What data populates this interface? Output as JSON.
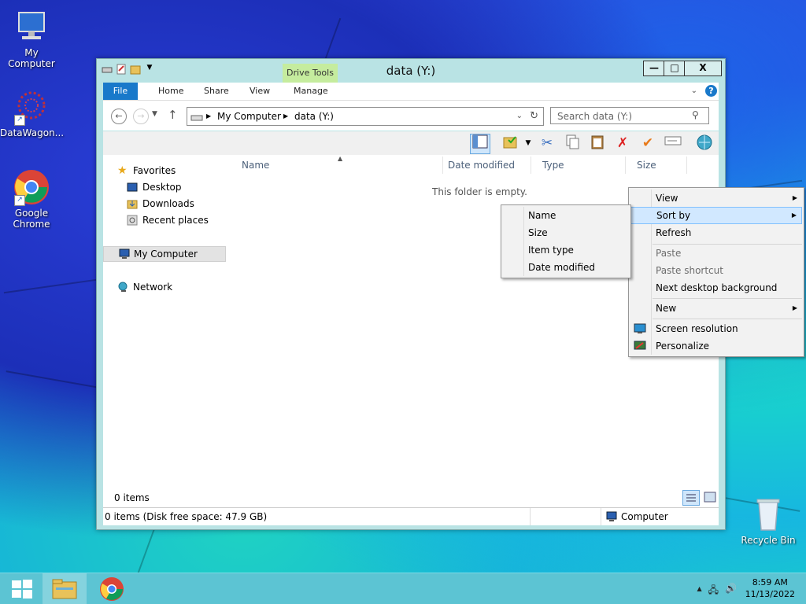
{
  "desktop": {
    "icons": [
      {
        "label": "My Computer"
      },
      {
        "label": "DataWagon..."
      },
      {
        "label": "Google Chrome"
      },
      {
        "label": "Recycle Bin"
      }
    ]
  },
  "window": {
    "title": "data (Y:)",
    "contextual_tab": "Drive Tools",
    "tabs": [
      "File",
      "Home",
      "Share",
      "View",
      "Manage"
    ],
    "help_label": "?",
    "buttons": {
      "minimize": "—",
      "maximize": "□",
      "close": "X"
    }
  },
  "address": {
    "crumbs": [
      "My Computer",
      "data (Y:)"
    ],
    "search_placeholder": "Search data (Y:)"
  },
  "nav": {
    "favorites": "Favorites",
    "desktop": "Desktop",
    "downloads": "Downloads",
    "recent": "Recent places",
    "computer": "My Computer",
    "network": "Network"
  },
  "columns": [
    "Name",
    "Date modified",
    "Type",
    "Size"
  ],
  "empty_message": "This folder is empty.",
  "status": {
    "items": "0 items",
    "details": "0 items (Disk free space: 47.9 GB)",
    "location": "Computer"
  },
  "context_menu": {
    "items": [
      {
        "label": "View",
        "submenu": true
      },
      {
        "label": "Sort by",
        "submenu": true,
        "highlighted": true
      },
      {
        "label": "Refresh"
      },
      {
        "label": "Paste",
        "disabled": true
      },
      {
        "label": "Paste shortcut",
        "disabled": true
      },
      {
        "label": "Next desktop background"
      },
      {
        "label": "New",
        "submenu": true
      },
      {
        "label": "Screen resolution",
        "icon": "monitor-icon"
      },
      {
        "label": "Personalize",
        "icon": "personalize-icon"
      }
    ]
  },
  "sort_submenu": {
    "items": [
      "Name",
      "Size",
      "Item type",
      "Date modified"
    ]
  },
  "taskbar": {
    "time": "8:59 AM",
    "date": "11/13/2022"
  }
}
